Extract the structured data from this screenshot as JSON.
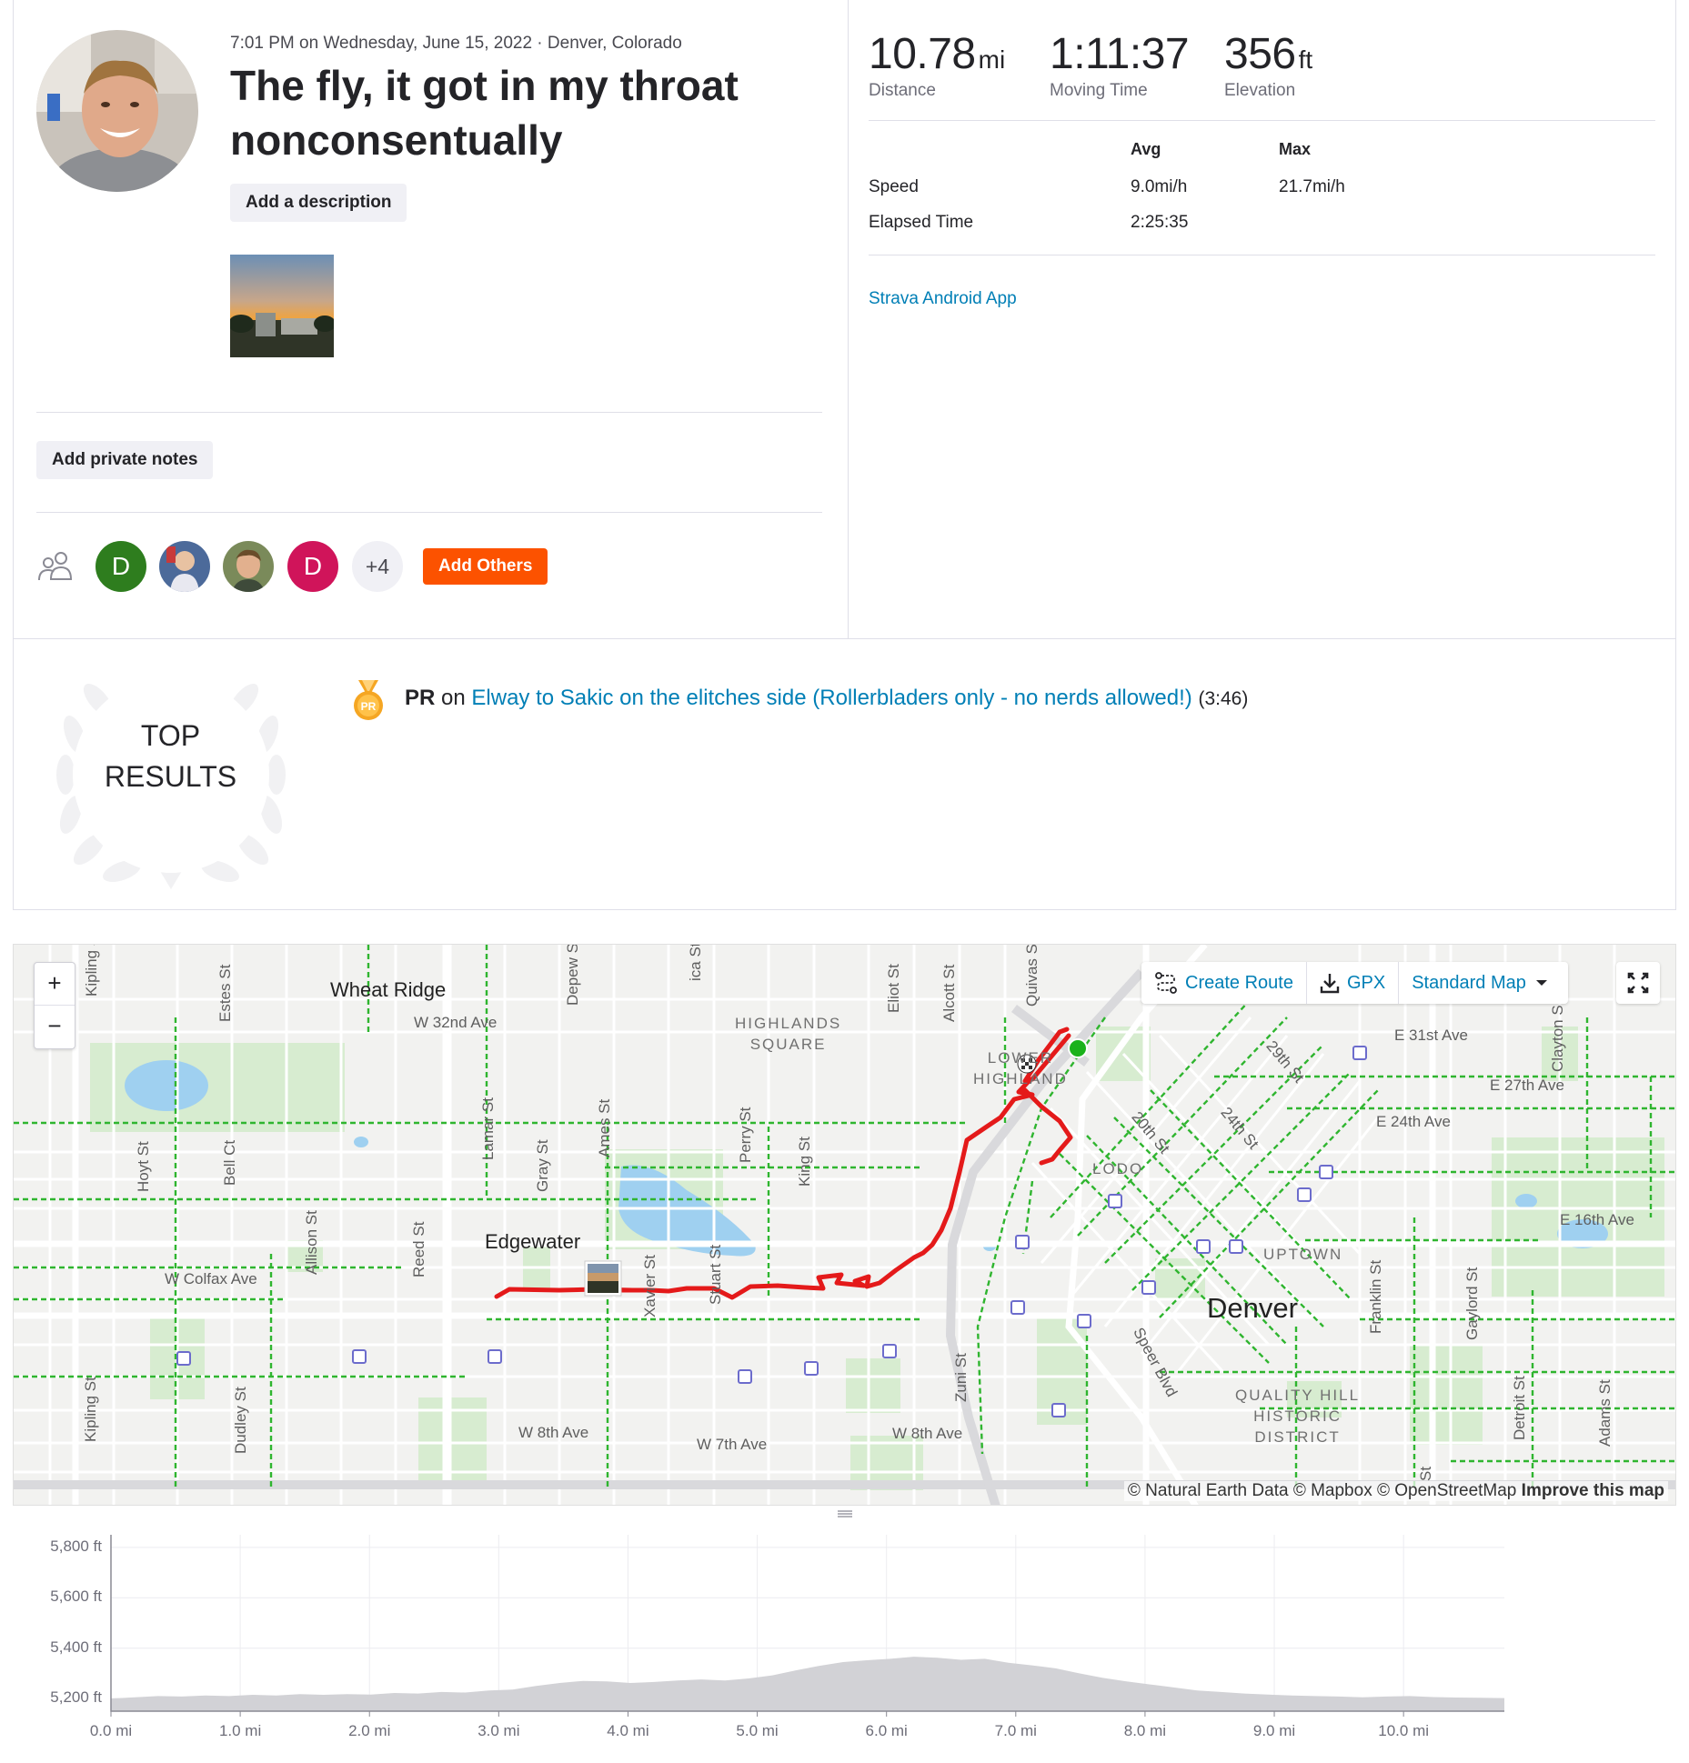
{
  "activity": {
    "meta": "7:01 PM on Wednesday, June 15, 2022 · Denver, Colorado",
    "title": "The fly, it got in my throat nonconsentually",
    "add_description_label": "Add a description",
    "add_notes_label": "Add private notes",
    "source_app": "Strava Android App"
  },
  "stats": {
    "distance": {
      "value": "10.78",
      "unit": "mi",
      "label": "Distance"
    },
    "moving_time": {
      "value": "1:11:37",
      "label": "Moving Time"
    },
    "elevation": {
      "value": "356",
      "unit": "ft",
      "label": "Elevation"
    },
    "table": {
      "head_avg": "Avg",
      "head_max": "Max",
      "rows": [
        {
          "label": "Speed",
          "avg": "9.0mi/h",
          "max": "21.7mi/h"
        },
        {
          "label": "Elapsed Time",
          "avg": "2:25:35",
          "max": ""
        }
      ]
    }
  },
  "group": {
    "avatars": [
      {
        "initial": "D",
        "color": "#2e7d1e"
      },
      {
        "initial": "",
        "color": "#4c6a9a"
      },
      {
        "initial": "",
        "color": "#7a8a5a"
      },
      {
        "initial": "D",
        "color": "#d0145a"
      }
    ],
    "more": "+4",
    "add_others_label": "Add Others"
  },
  "top_results": {
    "heading_line1": "TOP",
    "heading_line2": "RESULTS",
    "medal_text": "PR",
    "pr_prefix": "PR",
    "pr_on": "on",
    "segment_name": "Elway to Sakic on the elitches side (Rollerbladers only - no nerds allowed!)",
    "segment_time": "(3:46)"
  },
  "map": {
    "toolbar": {
      "create_route": "Create Route",
      "gpx": "GPX",
      "map_style": "Standard Map"
    },
    "zoom_in": "+",
    "zoom_out": "−",
    "attribution": "© Natural Earth Data © Mapbox © OpenStreetMap",
    "improve": "Improve this map",
    "labels": {
      "wheat_ridge": "Wheat Ridge",
      "edgewater": "Edgewater",
      "denver": "Denver",
      "highlands_square_1": "HIGHLANDS",
      "highlands_square_2": "SQUARE",
      "lower_highland_1": "LOWER",
      "lower_highland_2": "HIGHLAND",
      "lodo": "LODO",
      "uptown": "UPTOWN",
      "quality_hill_1": "QUALITY HILL",
      "quality_hill_2": "HISTORIC",
      "quality_hill_3": "DISTRICT",
      "w32nd": "W 32nd Ave",
      "wcolfax": "W Colfax Ave",
      "w8th_a": "W 8th Ave",
      "w7th": "W 7th Ave",
      "w8th_b": "W 8th Ave",
      "e31st": "E 31st Ave",
      "e27th": "E 27th Ave",
      "e24th": "E 24th Ave",
      "e16th": "E 16th Ave",
      "estes": "Estes St",
      "kipling_top": "Kipling St",
      "kipling": "Kipling St",
      "hoyt": "Hoyt St",
      "bell": "Bell Ct",
      "allison": "Allison St",
      "reed": "Reed St",
      "lamar": "Lamar St",
      "gray": "Gray St",
      "ames": "Ames St",
      "depew": "Depew S",
      "dudley": "Dudley St",
      "xavier": "Xavier St",
      "stuart": "Stuart St",
      "perry": "Perry St",
      "king": "King St",
      "eliot": "Eliot St",
      "alcott": "Alcott St",
      "quivas": "Quivas S",
      "zuni": "Zuni St",
      "ica": "ica St",
      "speer": "Speer Blvd",
      "s20th": "20th St",
      "s24th": "24th St",
      "s29th": "29th St",
      "franklin": "Franklin St",
      "gaylord": "Gaylord St",
      "detroit": "Detroit St",
      "adams": "Adams St",
      "clayton": "Clayton S",
      "st_bottom": "St"
    }
  },
  "elevation": {
    "y_labels": [
      "5,800 ft",
      "5,600 ft",
      "5,400 ft",
      "5,200 ft"
    ],
    "x_labels": [
      "0.0 mi",
      "1.0 mi",
      "2.0 mi",
      "3.0 mi",
      "4.0 mi",
      "5.0 mi",
      "6.0 mi",
      "7.0 mi",
      "8.0 mi",
      "9.0 mi",
      "10.0 mi"
    ],
    "profile_ft": [
      5200,
      5205,
      5210,
      5208,
      5212,
      5210,
      5215,
      5212,
      5218,
      5215,
      5218,
      5216,
      5222,
      5220,
      5226,
      5224,
      5232,
      5236,
      5250,
      5262,
      5270,
      5268,
      5262,
      5266,
      5272,
      5276,
      5272,
      5280,
      5292,
      5312,
      5330,
      5345,
      5352,
      5358,
      5366,
      5362,
      5354,
      5358,
      5342,
      5332,
      5320,
      5300,
      5282,
      5268,
      5256,
      5244,
      5232,
      5226,
      5220,
      5216,
      5212,
      5210,
      5208,
      5205,
      5208,
      5210,
      5206,
      5204,
      5203,
      5202
    ],
    "y_range": [
      5150,
      5850
    ],
    "x_max_mi": 10.78
  }
}
